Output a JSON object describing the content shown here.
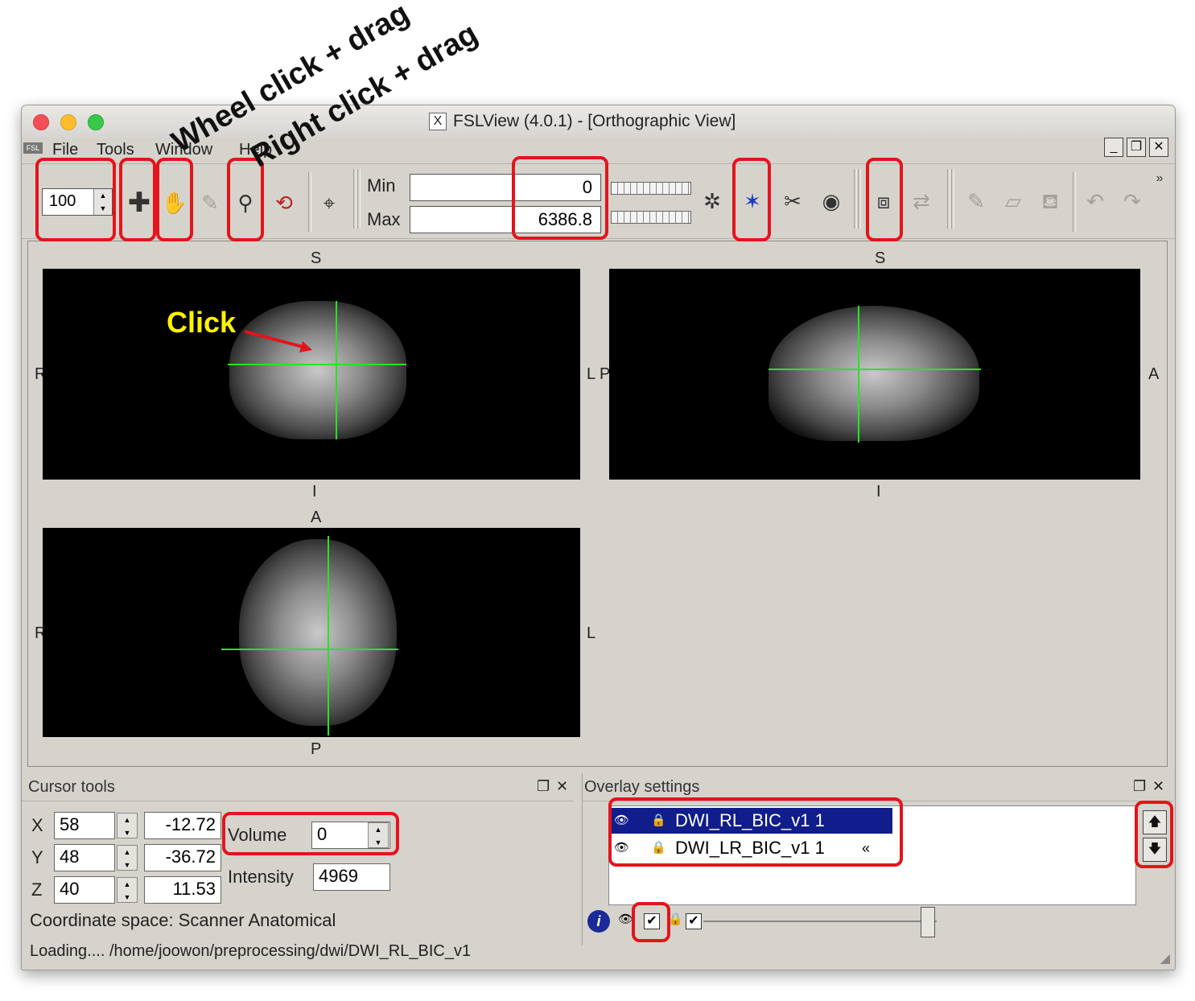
{
  "window": {
    "title": "FSLView (4.0.1) - [Orthographic View]",
    "app_icon": "FSL"
  },
  "menu": [
    "File",
    "Tools",
    "Window",
    "Help"
  ],
  "toolbar": {
    "zoom_value": "100",
    "min_label": "Min",
    "min_value": "0",
    "max_label": "Max",
    "max_value": "6386.8",
    "more": "»"
  },
  "views": {
    "coronal": {
      "top": "S",
      "bottom": "I",
      "left": "R",
      "right": "L"
    },
    "sagittal": {
      "top": "S",
      "bottom": "I",
      "left": "P",
      "right": "A"
    },
    "axial": {
      "top": "A",
      "bottom": "P",
      "left": "R",
      "right": "L"
    }
  },
  "cursor_tools": {
    "title": "Cursor tools",
    "x_label": "X",
    "x_vox": "58",
    "x_mm": "-12.72",
    "y_label": "Y",
    "y_vox": "48",
    "y_mm": "-36.72",
    "z_label": "Z",
    "z_vox": "40",
    "z_mm": "11.53",
    "volume_label": "Volume",
    "volume_value": "0",
    "intensity_label": "Intensity",
    "intensity_value": "4969",
    "coord_space": "Coordinate space: Scanner Anatomical"
  },
  "overlay_settings": {
    "title": "Overlay settings",
    "layers": [
      {
        "name": "DWI_RL_BIC_v1 1",
        "selected": true
      },
      {
        "name": "DWI_LR_BIC_v1 1",
        "selected": false
      }
    ]
  },
  "status": "Loading.... /home/joowon/preprocessing/dwi/DWI_RL_BIC_v1",
  "annotations": {
    "wheel": "Wheel click + drag",
    "right": "Right click + drag",
    "click": "Click"
  },
  "colors": {
    "highlight": "#e3141c",
    "crosshair": "#27e327",
    "selection": "#111d8b",
    "click_label": "#fff200"
  }
}
